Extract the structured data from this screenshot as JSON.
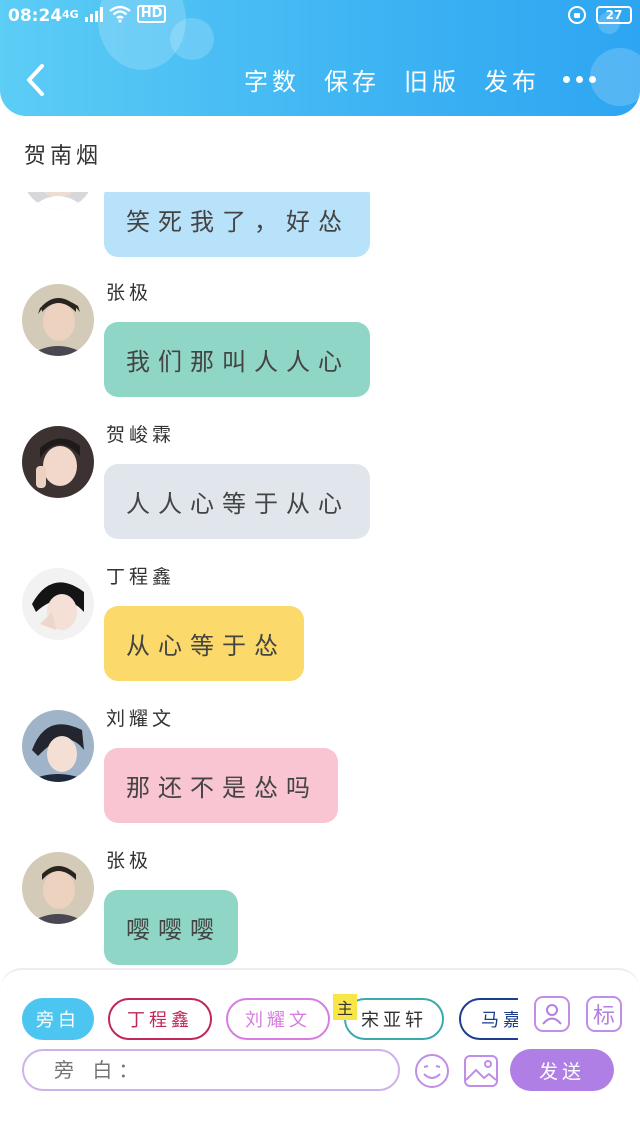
{
  "status_bar": {
    "time": "08:24",
    "network": "4G",
    "hd": "HD",
    "battery": "27"
  },
  "header": {
    "actions": [
      "字数",
      "保存",
      "旧版",
      "发布"
    ],
    "more_icon": "more-dots-icon",
    "back_icon": "back-arrow-icon"
  },
  "title": "贺南烟",
  "messages": [
    {
      "sender": "",
      "text": "笑死我了，好怂",
      "color": "#b8e2f9"
    },
    {
      "sender": "张极",
      "text": "我们那叫人人心",
      "color": "#8fd6c6"
    },
    {
      "sender": "贺峻霖",
      "text": "人人心等于从心",
      "color": "#e1e6ed"
    },
    {
      "sender": "丁程鑫",
      "text": "从心等于怂",
      "color": "#fbd96b"
    },
    {
      "sender": "刘耀文",
      "text": "那还不是怂吗",
      "color": "#f9c5d2"
    },
    {
      "sender": "张极",
      "text": "嘤嘤嘤",
      "color": "#8fd6c6"
    }
  ],
  "input": {
    "roles": [
      {
        "label": "旁白",
        "active": true,
        "color": "#4cc6f0"
      },
      {
        "label": "丁程鑫",
        "active": false,
        "color": "#c0275a"
      },
      {
        "label": "刘耀文",
        "active": false,
        "color": "#d87de0"
      },
      {
        "label": "宋亚轩",
        "active": false,
        "color": "#3aaab0"
      },
      {
        "label": "马嘉祺",
        "active": false,
        "color": "#1d3d8f"
      }
    ],
    "main_badge": "主",
    "tag_button": "标",
    "placeholder": "旁 白：",
    "send_label": "发送"
  }
}
